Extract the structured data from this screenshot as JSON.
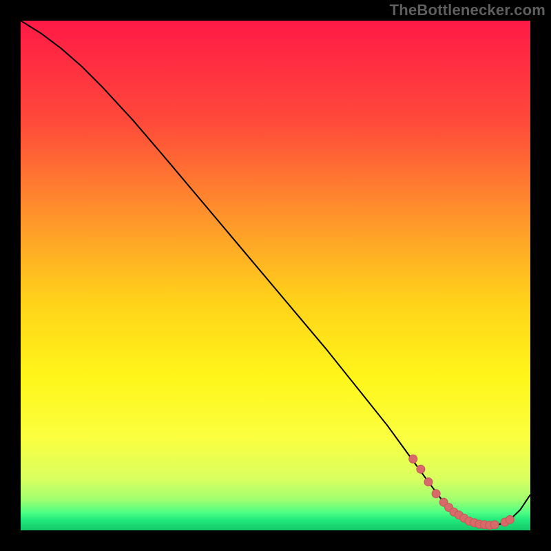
{
  "watermark": "TheBottlenecker.com",
  "colors": {
    "background": "#000000",
    "watermark_text": "#5f5f5f",
    "curve": "#000000",
    "marker_fill": "#d86a6a",
    "marker_stroke": "#c05858"
  },
  "chart_data": {
    "type": "line",
    "title": "",
    "xlabel": "",
    "ylabel": "",
    "xlim": [
      0,
      100
    ],
    "ylim": [
      0,
      100
    ],
    "gradient_stops": [
      {
        "offset": 0.0,
        "color": "#ff1a46"
      },
      {
        "offset": 0.2,
        "color": "#ff4a3a"
      },
      {
        "offset": 0.4,
        "color": "#ff9a2a"
      },
      {
        "offset": 0.55,
        "color": "#ffd21a"
      },
      {
        "offset": 0.7,
        "color": "#fff61a"
      },
      {
        "offset": 0.82,
        "color": "#faff40"
      },
      {
        "offset": 0.9,
        "color": "#d8ff60"
      },
      {
        "offset": 0.94,
        "color": "#a0ff70"
      },
      {
        "offset": 0.965,
        "color": "#4dff84"
      },
      {
        "offset": 0.98,
        "color": "#20e87a"
      },
      {
        "offset": 1.0,
        "color": "#14c86c"
      }
    ],
    "series": [
      {
        "name": "curve",
        "x": [
          0,
          4,
          8,
          12,
          16,
          22,
          28,
          36,
          44,
          52,
          60,
          66,
          72,
          76,
          80,
          83,
          86,
          88,
          90,
          92,
          94,
          96,
          98,
          100
        ],
        "y": [
          100,
          97.5,
          94.5,
          91,
          87,
          80.5,
          73.5,
          64,
          54.5,
          45,
          35.5,
          28,
          20.5,
          15,
          9.5,
          5.5,
          3,
          1.8,
          1.2,
          1.0,
          1.2,
          2.1,
          4.0,
          7.0
        ]
      }
    ],
    "markers": {
      "name": "highlight-dots",
      "x": [
        77,
        78.5,
        80,
        81.5,
        83,
        84,
        85,
        86,
        87,
        88,
        89,
        90,
        91,
        92,
        93,
        95,
        96
      ],
      "y": [
        14.0,
        12.0,
        9.5,
        7.2,
        5.5,
        4.5,
        3.6,
        3.0,
        2.4,
        1.8,
        1.5,
        1.2,
        1.1,
        1.0,
        1.1,
        1.6,
        2.1
      ]
    }
  }
}
